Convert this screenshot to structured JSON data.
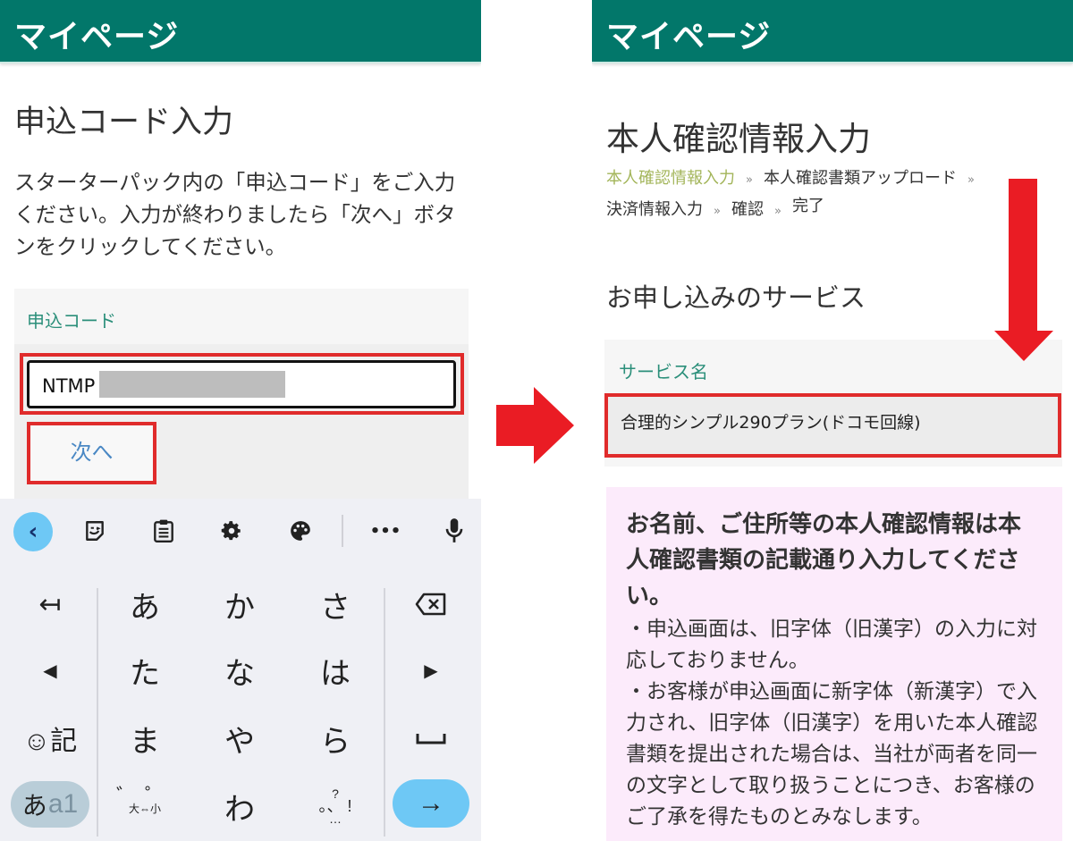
{
  "left": {
    "appbar_title": "マイページ",
    "page_title": "申込コード入力",
    "instructions": "スターターパック内の「申込コード」をご入力ください。入力が終わりましたら「次へ」ボタンをクリックしてください。",
    "form": {
      "label": "申込コード",
      "input_value": "NTMP",
      "redacted": true,
      "next_label": "次へ"
    },
    "keyboard": {
      "toolbar": {
        "back": "‹",
        "sticker": "sticker-icon",
        "clipboard": "clipboard-icon",
        "settings": "gear-icon",
        "theme": "palette-icon",
        "more": "•••",
        "mic": "mic-icon"
      },
      "keys": {
        "undo": "↤",
        "a": "あ",
        "ka": "か",
        "sa": "さ",
        "backspace": "⌫",
        "left": "◀",
        "ta": "た",
        "na": "な",
        "ha": "は",
        "right": "▶",
        "emoji_symbol": "☺記",
        "ma": "ま",
        "ya": "や",
        "ra": "ら",
        "space": "␣",
        "mode_a": "あ",
        "mode_a1": "a1",
        "dakuten_top": "゛゜",
        "dakuten_bottom": "大⇔小",
        "wa": "わ",
        "punct_top": "?",
        "punct_mid": "。、 !",
        "punct_bottom": "…",
        "enter": "→"
      }
    }
  },
  "right": {
    "appbar_title": "マイページ",
    "page_title": "本人確認情報入力",
    "breadcrumb": {
      "step1": "本人確認情報入力",
      "step2": "本人確認書類アップロード",
      "step3": "決済情報入力",
      "step4": "確認",
      "step5": "完了",
      "separator": "»"
    },
    "section_title": "お申し込みのサービス",
    "service": {
      "label": "サービス名",
      "value": "合理的シンプル290プラン(ドコモ回線)"
    },
    "notice": {
      "heading": "お名前、ご住所等の本人確認情報は本人確認書類の記載通り入力してください。",
      "item1": "・申込画面は、旧字体（旧漢字）の入力に対応しておりません。",
      "item2": "・お客様が申込画面に新字体（新漢字）で入力され、旧字体（旧漢字）を用いた本人確認書類を提出された場合は、当社が両者を同一の文字として取り扱うことにつき、お客様のご了承を得たものとみなします。"
    }
  },
  "annotations": {
    "highlight_color": "#e02b2b",
    "arrow_color": "#ea1c24",
    "brand_color": "#02776a"
  }
}
